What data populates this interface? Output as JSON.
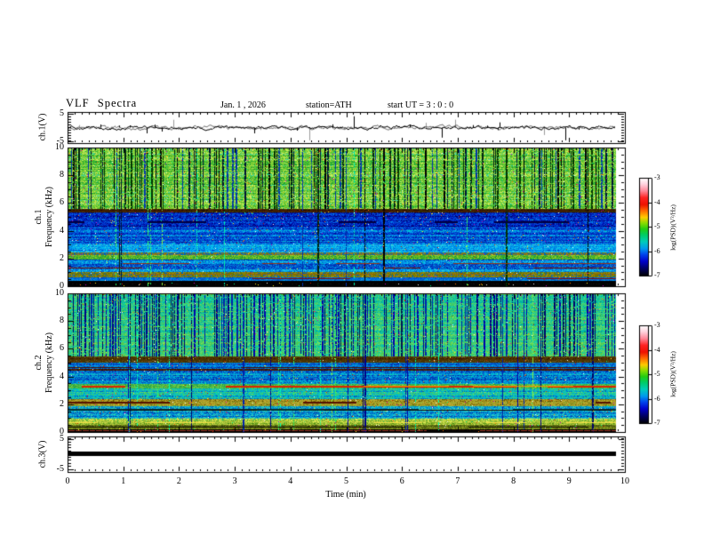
{
  "window": {
    "background": "#ffffff"
  },
  "header": {
    "title": "VLF Spectra",
    "date": "Jan. 1 , 2026",
    "station": "station=ATH",
    "start_ut": "start UT =  3 : 0 : 0"
  },
  "chart_data": {
    "type": "heatmap",
    "title": "VLF Spectra",
    "xlabel": "Time (min)",
    "x_range_min": [
      0,
      10
    ],
    "x_major_ticks": [
      0,
      1,
      2,
      3,
      4,
      5,
      6,
      7,
      8,
      9,
      10
    ],
    "x_minor_step": 0.125,
    "data_end_min": 9.82,
    "grid": false,
    "colorbar": {
      "label": "log(PSD)(V²/Hz)",
      "ticks": [
        -3,
        -4,
        -5,
        -6,
        -7
      ],
      "stops": [
        {
          "t": 0.0,
          "c": "#ffffff"
        },
        {
          "t": 0.06,
          "c": "#ffd5e0"
        },
        {
          "t": 0.13,
          "c": "#ff8899"
        },
        {
          "t": 0.2,
          "c": "#ff2222"
        },
        {
          "t": 0.27,
          "c": "#ee1100"
        },
        {
          "t": 0.33,
          "c": "#ff6600"
        },
        {
          "t": 0.4,
          "c": "#ffcc00"
        },
        {
          "t": 0.46,
          "c": "#88dd00"
        },
        {
          "t": 0.52,
          "c": "#22cc11"
        },
        {
          "t": 0.58,
          "c": "#00cc66"
        },
        {
          "t": 0.65,
          "c": "#00ccbb"
        },
        {
          "t": 0.72,
          "c": "#0099ee"
        },
        {
          "t": 0.78,
          "c": "#0044ee"
        },
        {
          "t": 0.85,
          "c": "#0000cc"
        },
        {
          "t": 0.92,
          "c": "#000066"
        },
        {
          "t": 1.0,
          "c": "#000000"
        }
      ]
    },
    "panels": [
      {
        "id": "ch1-waveform",
        "kind": "waveform",
        "ylabel": "ch.1(V)",
        "ylim": [
          -5.8,
          5.8
        ],
        "yticks": [
          5,
          -5
        ],
        "y_minor_step": 1,
        "baseline": 0,
        "noise_amplitude": 0.9,
        "spike_probability": 0.05,
        "spike_max": 4.8,
        "gray_spike_fraction": 0.25,
        "line_color": "#000000",
        "spike_gray": "#999999",
        "seed": 20260101
      },
      {
        "id": "ch1-spectrogram",
        "kind": "spectrogram",
        "ylabel_line1": "ch.1",
        "ylabel_line2": "Frequency  (kHz)",
        "ylim_khz": [
          0,
          10
        ],
        "yticks": [
          10,
          8,
          6,
          4,
          2,
          0
        ],
        "y_minor_step": 0.5,
        "seed": 101,
        "accent_prob": 0.015,
        "accent_colors": [
          "#cc2200",
          "#ff7700",
          "#ffffff",
          "#cc00bb",
          "#ffee22",
          "#00ff88"
        ],
        "striations": {
          "min_khz": 5.55,
          "density": 0.3,
          "full_height_prob": 0.1,
          "bright_prob": 0.02,
          "colors": [
            "#000000",
            "#001133",
            "#002211",
            "#0033aa",
            "#003300"
          ],
          "bright_colors": [
            "#33ee66",
            "#88ee44",
            "#00eeaa"
          ]
        },
        "bands": [
          {
            "khz": [
              0,
              0.35
            ],
            "colors": [
              "#000000",
              "#000000",
              "#050505",
              "#101010"
            ]
          },
          {
            "khz": [
              0.35,
              0.6
            ],
            "colors": [
              "#0033bb",
              "#0055cc",
              "#0077dd",
              "#0099ee"
            ]
          },
          {
            "khz": [
              0.6,
              1.0
            ],
            "colors": [
              "#554400",
              "#887700",
              "#998811",
              "#667700",
              "#0066bb"
            ]
          },
          {
            "khz": [
              1.0,
              1.9
            ],
            "colors": [
              "#0022aa",
              "#0033bb",
              "#0055cc",
              "#0088dd",
              "#00aaee",
              "#22ccdd"
            ]
          },
          {
            "khz": [
              1.9,
              2.2
            ],
            "colors": [
              "#118833",
              "#33aa33",
              "#66bb22",
              "#99cc33",
              "#00bb77"
            ]
          },
          {
            "khz": [
              2.2,
              2.45
            ],
            "colors": [
              "#556600",
              "#777711",
              "#997722",
              "#0066bb",
              "#0099cc"
            ]
          },
          {
            "khz": [
              2.45,
              3.0
            ],
            "colors": [
              "#0044cc",
              "#0077dd",
              "#0099ee",
              "#00bbee",
              "#33ccdd",
              "#55ddcc"
            ]
          },
          {
            "khz": [
              3.0,
              4.3
            ],
            "colors": [
              "#001199",
              "#0022bb",
              "#0044cc",
              "#0066dd",
              "#0099ee",
              "#00cccc"
            ]
          },
          {
            "khz": [
              4.3,
              5.3
            ],
            "colors": [
              "#000055",
              "#000077",
              "#0011aa",
              "#0033cc",
              "#0055dd",
              "#0088ee"
            ]
          },
          {
            "khz": [
              5.3,
              5.55
            ],
            "colors": [
              "#221100",
              "#442200",
              "#333300",
              "#554411"
            ]
          },
          {
            "khz": [
              5.55,
              10.05
            ],
            "colors": [
              "#119933",
              "#22aa33",
              "#44bb33",
              "#66cc33",
              "#88cc33",
              "#aadd44",
              "#ccee66",
              "#33cc99",
              "#55ddaa"
            ]
          }
        ],
        "lines": [
          {
            "khz": 5.42,
            "color": "#441100",
            "px": 1,
            "coverage": 0.85
          },
          {
            "khz": 4.62,
            "color": "#000044",
            "px": 2,
            "coverage": 0.5
          },
          {
            "khz": 1.62,
            "color": "#993311",
            "px": 1,
            "coverage": 0.45
          },
          {
            "khz": 1.3,
            "color": "#772200",
            "px": 1,
            "coverage": 0.35
          },
          {
            "khz": 0.82,
            "color": "#996600",
            "px": 1,
            "coverage": 0.55
          },
          {
            "khz": 0.5,
            "color": "#881100",
            "px": 1,
            "coverage": 0.3
          },
          {
            "khz": 0.35,
            "color": "#000000",
            "px": 2,
            "coverage": 0.95
          }
        ]
      },
      {
        "id": "ch2-spectrogram",
        "kind": "spectrogram",
        "ylabel_line1": "ch.2",
        "ylabel_line2": "Frequency  (kHz)",
        "ylim_khz": [
          0,
          10
        ],
        "yticks": [
          10,
          8,
          6,
          4,
          2,
          0
        ],
        "y_minor_step": 0.5,
        "seed": 202,
        "accent_prob": 0.015,
        "accent_colors": [
          "#cc2200",
          "#ff7700",
          "#ffffff",
          "#cc00bb",
          "#ffee22",
          "#00ff88"
        ],
        "striations": {
          "min_khz": 5.45,
          "density": 0.33,
          "full_height_prob": 0.08,
          "bright_prob": 0.03,
          "colors": [
            "#000088",
            "#0000aa",
            "#000066",
            "#0022aa",
            "#001155"
          ],
          "bright_colors": [
            "#33ee66",
            "#88ee44",
            "#00ffaa"
          ]
        },
        "bands": [
          {
            "khz": [
              0,
              0.14
            ],
            "colors": [
              "#000000",
              "#000000",
              "#110500"
            ]
          },
          {
            "khz": [
              0.14,
              0.5
            ],
            "colors": [
              "#223300",
              "#445511",
              "#667711",
              "#889922"
            ]
          },
          {
            "khz": [
              0.5,
              0.95
            ],
            "colors": [
              "#448811",
              "#77aa22",
              "#99bb33",
              "#bbcc44",
              "#ddee55",
              "#33bb55"
            ]
          },
          {
            "khz": [
              0.95,
              1.85
            ],
            "colors": [
              "#0033aa",
              "#0055bb",
              "#0088cc",
              "#00aadd",
              "#33ccbb",
              "#66cc77"
            ]
          },
          {
            "khz": [
              1.85,
              2.35
            ],
            "colors": [
              "#665500",
              "#887711",
              "#aa9922",
              "#bbaa33",
              "#88aa33",
              "#55aa44"
            ]
          },
          {
            "khz": [
              2.35,
              3.1
            ],
            "colors": [
              "#0066bb",
              "#0099cc",
              "#00bbcc",
              "#22cc99",
              "#44cc66",
              "#77dd66"
            ]
          },
          {
            "khz": [
              3.1,
              3.45
            ],
            "colors": [
              "#119944",
              "#33aa44",
              "#55bb44",
              "#77cc44",
              "#00aa88"
            ]
          },
          {
            "khz": [
              3.45,
              4.4
            ],
            "colors": [
              "#0022aa",
              "#0044bb",
              "#0077cc",
              "#0099dd",
              "#00bbcc",
              "#33ccaa"
            ]
          },
          {
            "khz": [
              4.4,
              4.55
            ],
            "colors": [
              "#331100",
              "#552200",
              "#443311"
            ]
          },
          {
            "khz": [
              4.55,
              5.0
            ],
            "colors": [
              "#001188",
              "#0033aa",
              "#0055cc",
              "#0088dd",
              "#00aadd"
            ]
          },
          {
            "khz": [
              5.0,
              5.45
            ],
            "colors": [
              "#331100",
              "#553300",
              "#443300",
              "#665522"
            ]
          },
          {
            "khz": [
              5.45,
              10.05
            ],
            "colors": [
              "#008877",
              "#00aa99",
              "#00bbaa",
              "#11ccaa",
              "#33cc88",
              "#44cc66",
              "#66dd66",
              "#55cc44",
              "#88dd55"
            ]
          }
        ],
        "lines": [
          {
            "khz": 4.62,
            "color": "#441100",
            "px": 1,
            "coverage": 0.8
          },
          {
            "khz": 3.3,
            "color": "#dd2200",
            "px": 2,
            "coverage": 0.7
          },
          {
            "khz": 3.3,
            "color": "#ff8800",
            "px": 1,
            "coverage": 0.25
          },
          {
            "khz": 2.12,
            "color": "#551100",
            "px": 2,
            "coverage": 0.4
          },
          {
            "khz": 1.62,
            "color": "#003333",
            "px": 2,
            "coverage": 0.85
          },
          {
            "khz": 1.58,
            "color": "#111111",
            "px": 1,
            "coverage": 0.6
          },
          {
            "khz": 0.62,
            "color": "#eedd44",
            "px": 1,
            "coverage": 0.5
          },
          {
            "khz": 0.3,
            "color": "#111100",
            "px": 1,
            "coverage": 0.9
          },
          {
            "khz": 0.07,
            "color": "#993322",
            "px": 1,
            "coverage": 0.9
          }
        ]
      },
      {
        "id": "ch3-waveform",
        "kind": "flatline",
        "ylabel": "ch.3(V)",
        "ylim": [
          -5.8,
          5.8
        ],
        "yticks": [
          5,
          -5
        ],
        "y_minor_step": 1,
        "value": 0.3,
        "thickness_px": 5,
        "color": "#000000"
      }
    ]
  }
}
